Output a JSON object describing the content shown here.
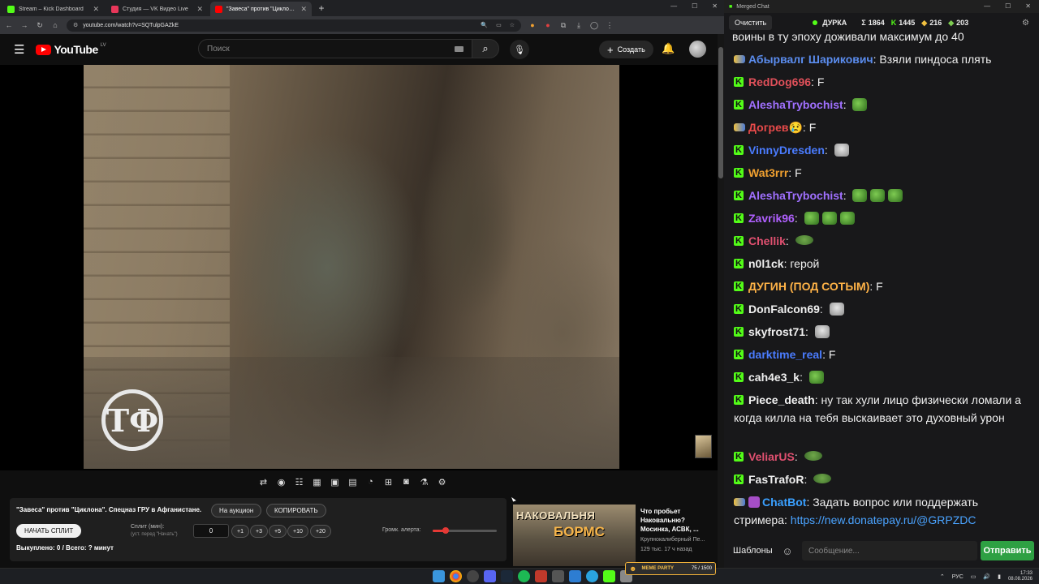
{
  "browser": {
    "tabs": [
      {
        "label": "Stream – Kick Dashboard",
        "color": "#53fc18",
        "active": false
      },
      {
        "label": "Студия — VK Видео Live",
        "color": "#e8375a",
        "active": false
      },
      {
        "label": "\"Завеса\" против \"Циклона\"",
        "color": "#ff0000",
        "active": true
      }
    ],
    "new_tab": "+",
    "url": "youtube.com/watch?v=SQTulpGAZkE"
  },
  "youtube": {
    "logo": "YouTube",
    "region": "LV",
    "search_placeholder": "Поиск",
    "create_label": "Создать",
    "video": {
      "logo_mark": "ТФ"
    }
  },
  "extension_panel": {
    "title": "\"Завеса\" против \"Циклона\". Спецназ ГРУ в Афганистане.",
    "auction_button": "На аукцион",
    "copy_button": "КОПИРОВАТЬ",
    "start_split_button": "НАЧАТЬ СПЛИТ",
    "split_label": "Сплит (мин):",
    "split_hint": "(уст. перед \"Начать\")",
    "split_value": "0",
    "add_buttons": [
      "+1",
      "+3",
      "+5",
      "+10",
      "+20"
    ],
    "alert_volume_label": "Громк. алерта:",
    "alert_volume": 0.2,
    "status": "Выкуплено: 0 / Всего: ? минут"
  },
  "recommendation": {
    "thumb_text_1": "НАКОВАЛЬНЯ",
    "thumb_text_2": "БОРМС",
    "title": "Что пробьет Наковальню? Мосинка, АСВК, ...",
    "channel": "Крупнокалиберный Пе...",
    "meta": "129 тыс.   17 ч назад"
  },
  "chat": {
    "window_title": "Merged Chat",
    "clear_button": "Очистить",
    "channel": "ДУРКА",
    "stats": {
      "total": "1864",
      "kick": "1445",
      "youtube": "216",
      "other": "203"
    },
    "cut_line": "воины в ту эпоху доживали максимум до 40",
    "messages": [
      {
        "platform": "youtube",
        "user": "Абырвалг Шарикович",
        "color": "#5b8def",
        "text": "Взяли пиндоса плять",
        "emotes": []
      },
      {
        "platform": "kick",
        "user": "RedDog696",
        "color": "#e0505a",
        "text": "F",
        "emotes": []
      },
      {
        "platform": "kick",
        "user": "AleshaTrybochist",
        "color": "#a070ff",
        "text": "",
        "emotes": [
          "frog"
        ]
      },
      {
        "platform": "youtube",
        "user": "Догрев😢",
        "color": "#e84a4a",
        "text": "F",
        "emotes": []
      },
      {
        "platform": "kick",
        "user": "VinnyDresden",
        "color": "#4a7cff",
        "text": "",
        "emotes": [
          "cat"
        ]
      },
      {
        "platform": "kick",
        "user": "Wat3rrr",
        "color": "#f0a030",
        "text": "F",
        "emotes": []
      },
      {
        "platform": "kick",
        "user": "AleshaTrybochist",
        "color": "#a070ff",
        "text": "",
        "emotes": [
          "frog",
          "frog",
          "frog"
        ]
      },
      {
        "platform": "kick",
        "user": "Zavrik96",
        "color": "#b060ff",
        "text": "",
        "emotes": [
          "frog",
          "frog",
          "frog"
        ]
      },
      {
        "platform": "kick",
        "user": "Chellik",
        "color": "#e05070",
        "text": "",
        "emotes": [
          "pepe"
        ]
      },
      {
        "platform": "kick",
        "user": "n0l1ck",
        "color": "#f0f0f0",
        "text": "герой",
        "emotes": []
      },
      {
        "platform": "kick",
        "user": "ДУГИН (ПОД СОТЫМ)",
        "color": "#ffb347",
        "text": "F",
        "emotes": []
      },
      {
        "platform": "kick",
        "user": "DonFalcon69",
        "color": "#f0f0f0",
        "text": "",
        "emotes": [
          "cat"
        ]
      },
      {
        "platform": "kick",
        "user": "skyfrost71",
        "color": "#f0f0f0",
        "text": "",
        "emotes": [
          "cat"
        ]
      },
      {
        "platform": "kick",
        "user": "darktime_real",
        "color": "#4a7cff",
        "text": "F",
        "emotes": []
      },
      {
        "platform": "kick",
        "user": "cah4e3_k",
        "color": "#f0f0f0",
        "text": "",
        "emotes": [
          "frog"
        ]
      },
      {
        "platform": "kick",
        "user": "Piece_death",
        "color": "#f0f0f0",
        "text": "ну так хули лицо физически ломали а когда килла на тебя выскаивает это духовный урон",
        "emotes": []
      },
      {
        "platform": "kick",
        "user": "VeliarUS",
        "color": "#e05070",
        "text": "",
        "emotes": [
          "pepe"
        ]
      },
      {
        "platform": "kick",
        "user": "FasTrafoR",
        "color": "#f0f0f0",
        "text": "",
        "emotes": [
          "pepe"
        ]
      },
      {
        "platform": "youtube",
        "user": "ChatBot",
        "color": "#3aa0ff",
        "text": "Задать вопрос или поддержать стримера: ",
        "link": "https://new.donatepay.ru/@GRPZDC",
        "emotes": []
      }
    ],
    "templates_button": "Шаблоны",
    "input_placeholder": "Сообщение...",
    "send_button": "Отправить"
  },
  "taskbar": {
    "meme_party_label": "MEME PARTY",
    "meme_party_progress": "75 / 1500",
    "language": "РУС",
    "time": "17:33",
    "date": "08.08.2026"
  }
}
